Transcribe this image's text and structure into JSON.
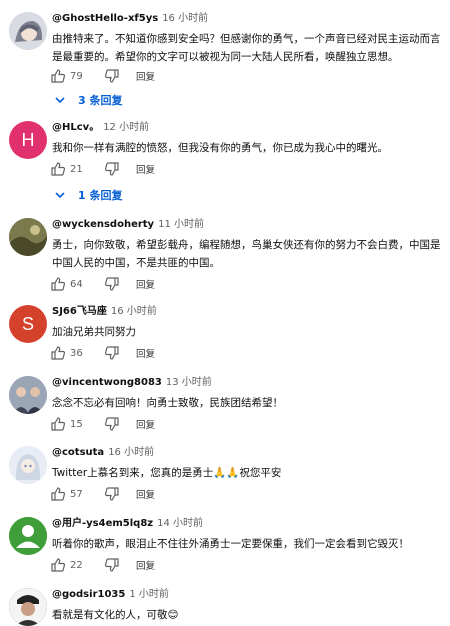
{
  "comments": [
    {
      "user": "@GhostHello-xf5ys",
      "time": "16 小时前",
      "text": "由推特来了。不知道你感到安全吗？但感谢你的勇气，一个声音已经对民主运动而言是最重要的。希望你的文字可以被视为同一大陆人民所看，唤醒独立思想。",
      "likes": "79",
      "reply_label": "回复",
      "replies_label": "3 条回复",
      "avatar": {
        "type": "image",
        "icon": "anime-character-avatar",
        "color": "#c9cbd3"
      }
    },
    {
      "user": "@HLcv。",
      "time": "12 小时前",
      "text": "我和你一样有满腔的愤怒，但我没有你的勇气，你已成为我心中的曙光。",
      "likes": "21",
      "reply_label": "回复",
      "replies_label": "1 条回复",
      "avatar": {
        "type": "letter",
        "letter": "H",
        "color": "#e0306e"
      }
    },
    {
      "user": "@wyckensdoherty",
      "time": "11 小时前",
      "text": "勇士，向你致敬，希望彭载舟，编程随想，鸟巢女侠还有你的努力不会白费，中国是中国人民的中国，不是共匪的中国。",
      "likes": "64",
      "reply_label": "回复",
      "avatar": {
        "type": "image",
        "icon": "landscape-avatar",
        "color": "#6d6a3f"
      }
    },
    {
      "user": "SJ66飞马座",
      "time": "16 小时前",
      "text": "加油兄弟共同努力",
      "likes": "36",
      "reply_label": "回复",
      "avatar": {
        "type": "letter",
        "letter": "S",
        "color": "#d4422c"
      }
    },
    {
      "user": "@vincentwong8083",
      "time": "13 小时前",
      "text": "念念不忘必有回响！向勇士致敬，民族团结希望！",
      "likes": "15",
      "reply_label": "回复",
      "avatar": {
        "type": "image",
        "icon": "group-photo-avatar",
        "color": "#8f9bab"
      }
    },
    {
      "user": "@cotsuta",
      "time": "16 小时前",
      "text": "Twitter上慕名到来，您真的是勇士🙏🙏祝您平安",
      "likes": "57",
      "reply_label": "回复",
      "avatar": {
        "type": "image",
        "icon": "anime-girl-avatar",
        "color": "#dfe6f0"
      }
    },
    {
      "user": "@用户-ys4em5lq8z",
      "time": "14 小时前",
      "text": "听着你的歌声，眼泪止不住往外涌勇士一定要保重，我们一定会看到它毁灭！",
      "likes": "22",
      "reply_label": "回复",
      "avatar": {
        "type": "image",
        "icon": "default-user-avatar",
        "color": "#3f9e3a"
      }
    },
    {
      "user": "@godsir1035",
      "time": "1 小时前",
      "text": "看就是有文化的人，可敬😊",
      "avatar": {
        "type": "image",
        "icon": "person-photo-avatar",
        "color": "#2b2b2b"
      }
    }
  ]
}
